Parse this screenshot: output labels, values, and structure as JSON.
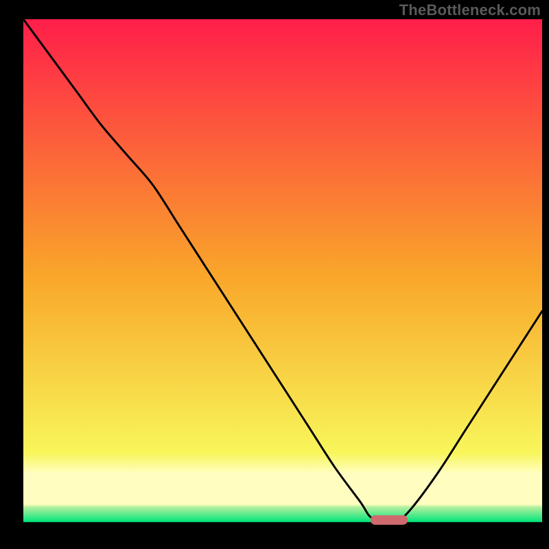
{
  "watermark": "TheBottleneck.com",
  "colors": {
    "black": "#000000",
    "red_top": "#ff1e4a",
    "orange_mid": "#f9a72a",
    "yellow_low": "#f8f65a",
    "pale_yellow": "#fffec0",
    "green": "#00e57a",
    "curve": "#000000",
    "marker_fill": "#cf6a6f",
    "marker_stroke": "#cf6a6f"
  },
  "chart_data": {
    "type": "line",
    "title": "",
    "xlabel": "",
    "ylabel": "",
    "xlim": [
      0,
      100
    ],
    "ylim": [
      0,
      100
    ],
    "x": [
      0,
      5,
      10,
      15,
      20,
      25,
      30,
      35,
      40,
      45,
      50,
      55,
      60,
      65,
      67,
      70,
      72,
      75,
      80,
      85,
      90,
      95,
      100
    ],
    "values": [
      100,
      93,
      86,
      79,
      73,
      67,
      59,
      51,
      43,
      35,
      27,
      19,
      11,
      4,
      1,
      0,
      0,
      3,
      10,
      18,
      26,
      34,
      42
    ],
    "optimum_marker": {
      "x_start": 67,
      "x_end": 74,
      "y": 0
    },
    "gradient_bands_pct_from_top": {
      "red_to_yellow_end": 84,
      "pale_band_end": 94,
      "green_band_end": 97.5,
      "black_baseline_start": 97.5
    }
  }
}
